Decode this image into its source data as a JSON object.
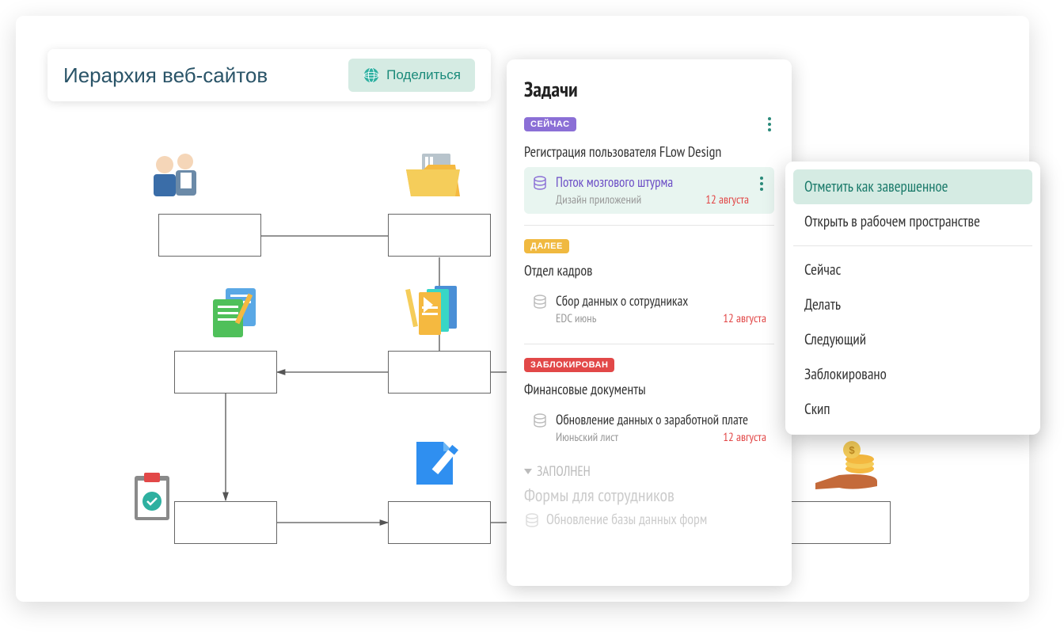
{
  "header": {
    "title": "Иерархия веб-сайтов",
    "share_label": "Поделиться"
  },
  "tasks_panel": {
    "title": "Задачи",
    "sections": {
      "now": {
        "badge": "СЕЙЧАС",
        "group_title": "Регистрация пользователя FLow Design",
        "task": {
          "name": "Поток мозгового штурма",
          "sub": "Дизайн приложений",
          "date": "12 августа"
        }
      },
      "next": {
        "badge": "ДАЛЕЕ",
        "group_title": "Отдел кадров",
        "task": {
          "name": "Сбор данных о сотрудниках",
          "sub": "EDC июнь",
          "date": "12 августа"
        }
      },
      "blocked": {
        "badge": "ЗАБЛОКИРОВАН",
        "group_title": "Финансовые документы",
        "task": {
          "name": "Обновление данных о заработной плате",
          "sub": "Июньский лист",
          "date": "12 августа"
        }
      },
      "completed": {
        "header": "ЗАПОЛНЕН",
        "group_title": "Формы для сотрудников",
        "task": "Обновление базы данных форм"
      }
    }
  },
  "context_menu": {
    "primary": [
      "Отметить как завершенное",
      "Открыть в рабочем пространстве"
    ],
    "statuses": [
      "Сейчас",
      "Делать",
      "Следующий",
      "Заблокировано",
      "Скип"
    ]
  },
  "diagram": {
    "icons": [
      "people",
      "folder",
      "documents",
      "books",
      "clipboard",
      "edit-document",
      "money-hand"
    ]
  }
}
